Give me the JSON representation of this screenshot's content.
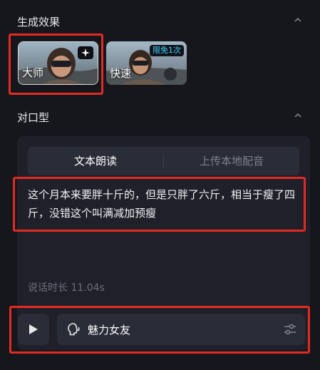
{
  "generation": {
    "title": "生成效果",
    "options": [
      {
        "label": "大师",
        "badge_icon": "sparkle-icon",
        "selected": true
      },
      {
        "label": "快速",
        "badge": "限免1次",
        "selected": false
      }
    ]
  },
  "lipsync": {
    "title": "对口型",
    "tabs": [
      {
        "label": "文本朗读",
        "active": true
      },
      {
        "label": "上传本地配音",
        "active": false
      }
    ],
    "script": "这个月本来要胖十斤的，但是只胖了六斤，相当于瘦了四斤，没错这个叫满减加预瘦",
    "duration_label": "说话时长 11.04s",
    "voice": {
      "name": "魅力女友",
      "icon": "voice-head-icon",
      "settings_icon": "sliders-icon"
    }
  },
  "colors": {
    "background": "#16171d",
    "panel": "#1f2029",
    "control": "#2a2c37",
    "highlight": "#e32a21",
    "badge_text": "#3fd6ff"
  }
}
